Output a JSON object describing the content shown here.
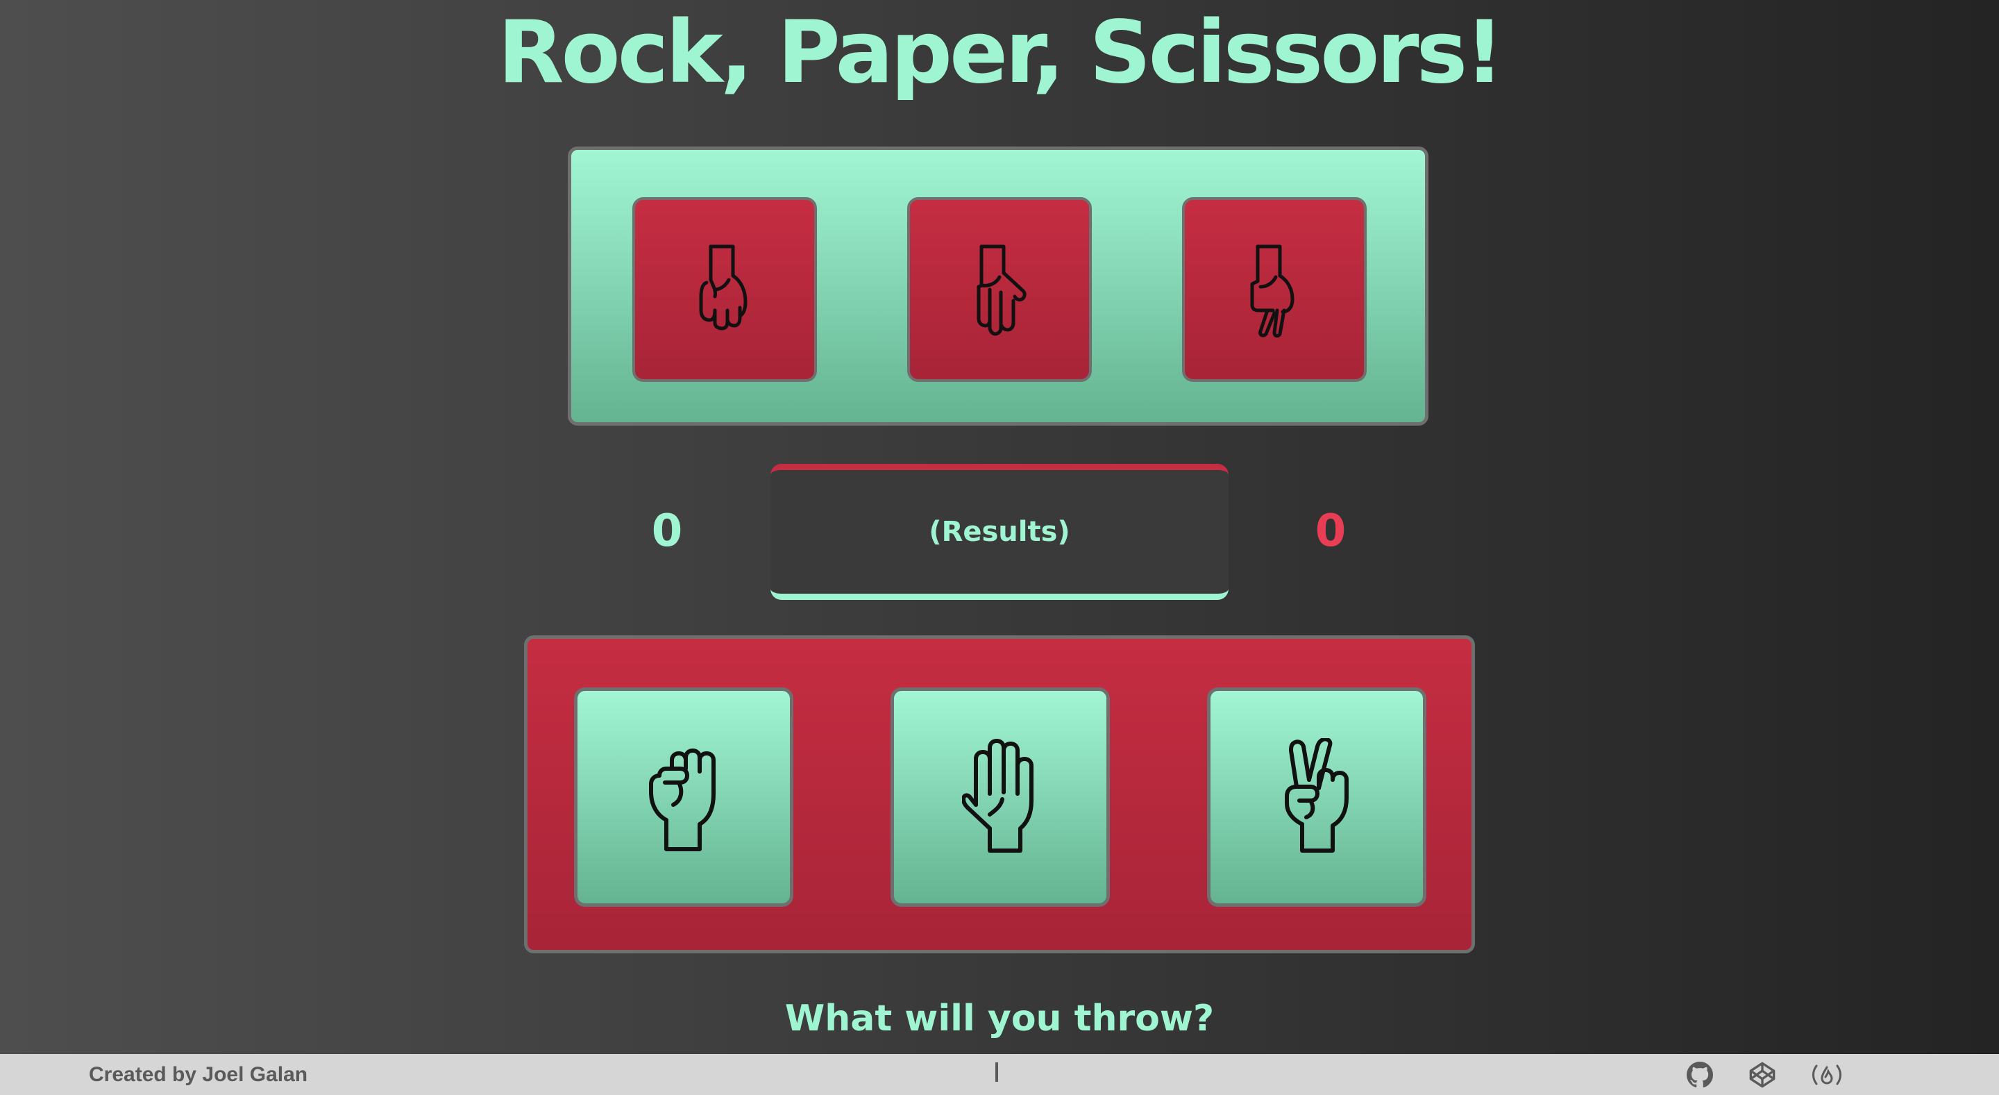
{
  "title": "Rock, Paper, Scissors!",
  "computer_choices": [
    {
      "name": "rock",
      "icon": "rock-hand-icon"
    },
    {
      "name": "paper",
      "icon": "paper-hand-icon"
    },
    {
      "name": "scissors",
      "icon": "scissors-hand-icon"
    }
  ],
  "scoreboard": {
    "player_score": "0",
    "computer_score": "0",
    "results_text": "(Results)"
  },
  "player_choices": [
    {
      "name": "rock",
      "icon": "fist-icon"
    },
    {
      "name": "paper",
      "icon": "open-hand-icon"
    },
    {
      "name": "scissors",
      "icon": "peace-sign-icon"
    }
  ],
  "prompt": "What will you throw?",
  "footer": {
    "credit": "Created by Joel Galan",
    "divider": "|",
    "links": [
      {
        "name": "github",
        "icon": "github-icon"
      },
      {
        "name": "codepen",
        "icon": "codepen-icon"
      },
      {
        "name": "freecodecamp",
        "icon": "freecodecamp-icon"
      }
    ]
  },
  "colors": {
    "mint": "#9ff5d1",
    "red": "#c52d42",
    "score_red": "#e83d55",
    "footer_bg": "#d6d6d6"
  }
}
